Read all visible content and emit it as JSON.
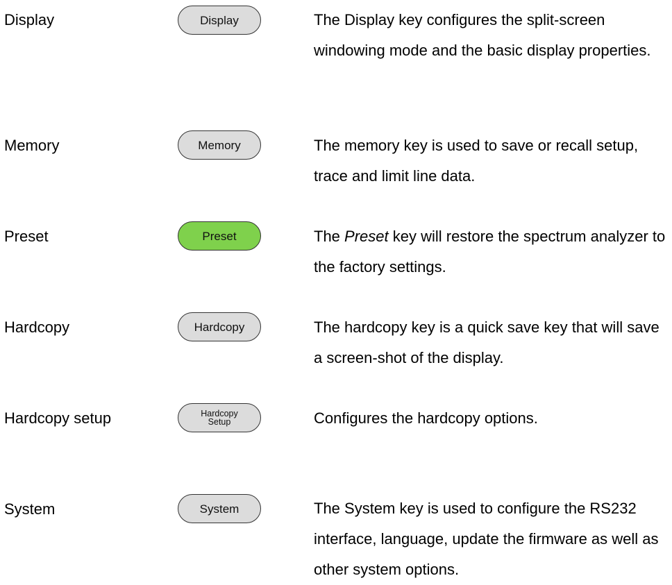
{
  "rows": [
    {
      "term": "Display",
      "key_label": "Display",
      "desc": "The Display key configures the split-screen windowing mode and the basic display properties."
    },
    {
      "term": "Memory",
      "key_label": "Memory",
      "desc": "The memory key is used to save or recall setup, trace and limit line data."
    },
    {
      "term": "Preset",
      "key_label": "Preset",
      "desc_before": "The ",
      "desc_emphasis": "Preset",
      "desc_after": " key will restore the spectrum analyzer to the factory settings."
    },
    {
      "term": "Hardcopy",
      "key_label": "Hardcopy",
      "desc": "The hardcopy key is a quick save key that will save a screen-shot of the display."
    },
    {
      "term": "Hardcopy setup",
      "key_label": "Hardcopy\nSetup",
      "desc": "Configures the hardcopy options."
    },
    {
      "term": "System",
      "key_label": "System",
      "desc": "The System key is used to configure the RS232 interface, language, update the firmware as well as other system options."
    }
  ],
  "colors": {
    "key_default": "#dcdcdc",
    "key_preset": "#7fd14c"
  }
}
